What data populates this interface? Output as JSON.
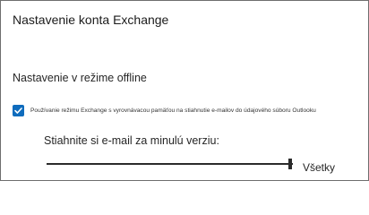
{
  "dialog": {
    "title": "Nastavenie konta Exchange",
    "section_title": "Nastavenie v režime offline",
    "cached_mode": {
      "checked": true,
      "label": "Používanie režimu Exchange s vyrovnávacou pamäťou na stiahnutie e-mailov do údajového súboru Outlooku"
    },
    "download": {
      "label": "Stiahnite si e-mail za minulú verziu:",
      "slider_fraction": 1.0,
      "value_label": "Všetky"
    },
    "accent_color": "#0f6cbd"
  }
}
